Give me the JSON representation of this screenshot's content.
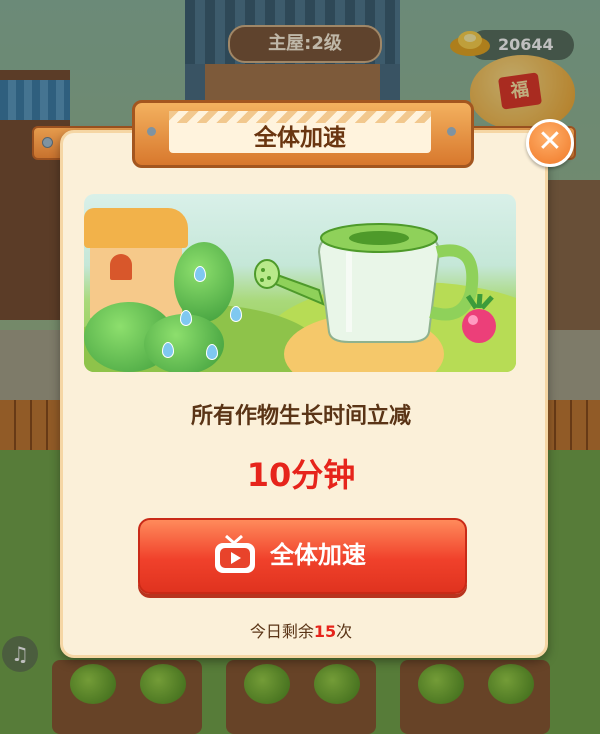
{
  "background": {
    "house_level_label": "主屋:2级",
    "coin_count": "20644",
    "piggy_bank_glyph": "福",
    "music_icon": "music-note-icon"
  },
  "dialog": {
    "title": "全体加速",
    "close_icon": "close-icon",
    "illustration": "watering-can-illustration",
    "description": "所有作物生长时间立减",
    "amount": "10分钟",
    "button_label": "全体加速",
    "button_icon": "tv-video-icon",
    "remaining_prefix": "今日剩余",
    "remaining_count": "15",
    "remaining_suffix": "次"
  },
  "colors": {
    "accent_red": "#e6241b",
    "button_gradient_top": "#ff8a5b",
    "panel_bg": "#fbf0d9",
    "title_text": "#6a3510"
  }
}
